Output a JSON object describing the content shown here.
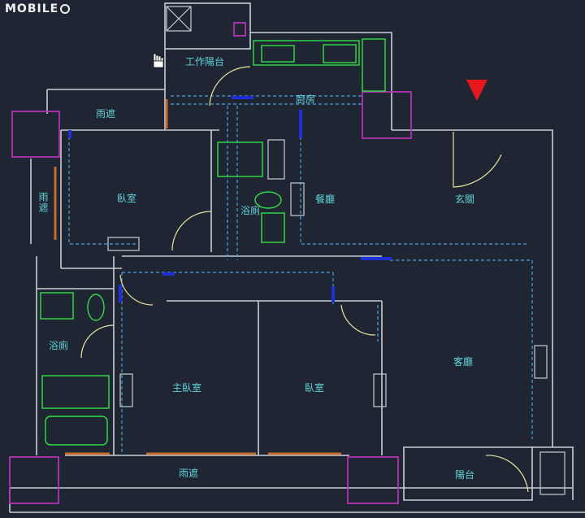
{
  "brand": {
    "text": "MOBILE"
  },
  "rooms": {
    "work_balcony": "工作陽台",
    "kitchen": "廚房",
    "rain_shelter_top": "雨遮",
    "rain_shelter_left": "雨遮",
    "bedroom_nw": "臥室",
    "bathroom_center": "浴廁",
    "dining": "餐廳",
    "entrance": "玄關",
    "bathroom_west": "浴廁",
    "master_bedroom": "主臥室",
    "bedroom_south": "臥室",
    "living": "客廳",
    "rain_shelter_bottom": "雨遮",
    "balcony": "陽台"
  },
  "colors": {
    "background": "#1f2532",
    "wall": "#c9cdd4",
    "label": "#5fd3d9",
    "dashed": "#4aa3df",
    "fixture": "#2fe04a",
    "column": "#b431b4",
    "marker": "#e8171c",
    "door": "#e6e6a0",
    "window": "#c46a2a",
    "opening": "#1e2fd8"
  },
  "icons": {
    "cursor": "hand-cursor-icon",
    "marker": "triangle-down-icon"
  }
}
